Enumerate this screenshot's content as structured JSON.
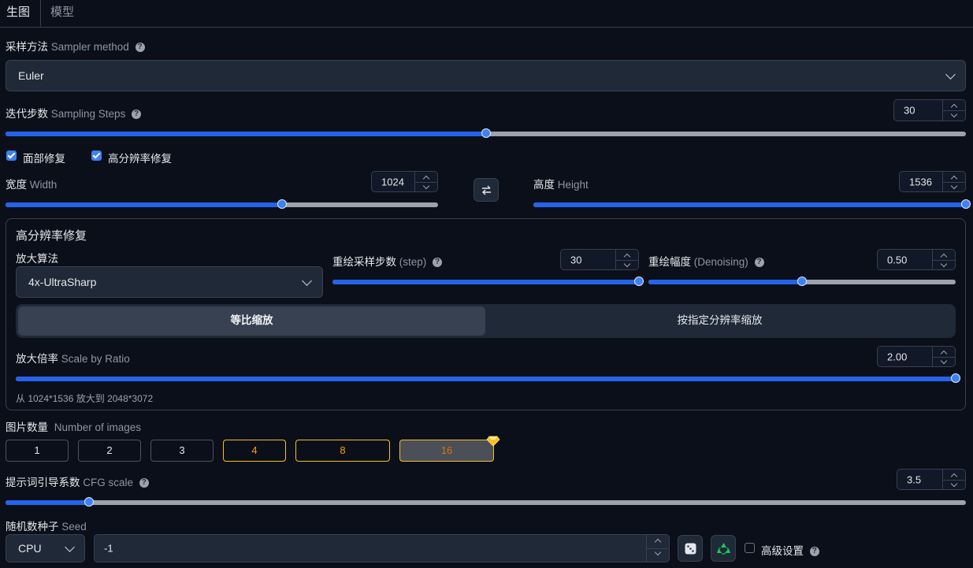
{
  "tabs": [
    {
      "label": "生图"
    },
    {
      "label": "模型"
    }
  ],
  "sampler": {
    "label_cn": "采样方法",
    "label_en": "Sampler method",
    "value": "Euler"
  },
  "steps": {
    "label_cn": "迭代步数",
    "label_en": "Sampling Steps",
    "value": "30",
    "fraction": 0.5
  },
  "checkboxes": [
    {
      "label": "面部修复",
      "checked": true
    },
    {
      "label": "高分辨率修复",
      "checked": true
    }
  ],
  "width": {
    "label_cn": "宽度",
    "label_en": "Width",
    "value": "1024",
    "fraction": 0.64
  },
  "swap_icon": "swap-arrows-icon",
  "height": {
    "label_cn": "高度",
    "label_en": "Height",
    "value": "1536",
    "fraction": 1.0
  },
  "hires": {
    "title": "高分辨率修复",
    "upscaler": {
      "label": "放大算法",
      "value": "4x-UltraSharp"
    },
    "hr_steps": {
      "label_cn": "重绘采样步数",
      "label_en": "(step)",
      "value": "30",
      "fraction": 1.0
    },
    "denoise": {
      "label_cn": "重绘幅度",
      "label_en": "(Denoising)",
      "value": "0.50",
      "fraction": 0.5
    },
    "modes": [
      {
        "label": "等比缩放",
        "active": true
      },
      {
        "label": "按指定分辨率缩放",
        "active": false
      }
    ],
    "scale": {
      "label_cn": "放大倍率",
      "label_en": "Scale by Ratio",
      "value": "2.00",
      "fraction": 1.0
    },
    "info": "从 1024*1536 放大到 2048*3072"
  },
  "images": {
    "label_cn": "图片数量",
    "label_en": "Number of images",
    "options": [
      {
        "label": "1"
      },
      {
        "label": "2"
      },
      {
        "label": "3"
      },
      {
        "label": "4"
      },
      {
        "label": "8"
      },
      {
        "label": "16"
      }
    ],
    "selected": "16",
    "premium_icon": "diamond-icon"
  },
  "cfg": {
    "label_cn": "提示词引导系数",
    "label_en": "CFG scale",
    "value": "3.5",
    "fraction": 0.087
  },
  "seed": {
    "label_cn": "随机数种子",
    "label_en": "Seed",
    "device": "CPU",
    "value": "-1",
    "dice_icon": "dice-icon",
    "recycle_icon": "recycle-icon",
    "advanced_label": "高级设置"
  },
  "colors": {
    "accent": "#2563eb",
    "bg": "#0b0f19",
    "gold": "#fbbf24"
  }
}
